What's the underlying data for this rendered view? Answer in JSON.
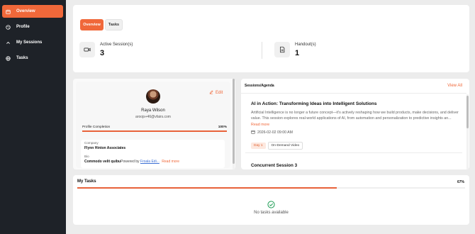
{
  "sidebar": {
    "items": [
      {
        "label": "Overview",
        "icon": "calendar-icon",
        "active": true
      },
      {
        "label": "Profile",
        "icon": "palette-icon",
        "active": false
      },
      {
        "label": "My Sessions",
        "icon": "chevron-up-icon",
        "active": false
      },
      {
        "label": "Tasks",
        "icon": "globe-icon",
        "active": false
      }
    ]
  },
  "overview": {
    "tabs": [
      "Overview",
      "Tasks"
    ],
    "stats": [
      {
        "label": "Active Session(s)",
        "value": "3",
        "icon": "video-camera-icon"
      },
      {
        "label": "Handout(s)",
        "value": "1",
        "icon": "document-icon"
      }
    ]
  },
  "profile": {
    "edit_label": "Edit",
    "name": "Raya Wilson",
    "email": "aroojs+46@vfairs.com",
    "completion_label": "Profile Completion",
    "completion_value": "100%",
    "completion_fraction": 1.0,
    "company_label": "Company",
    "company_value": "Flynn Hinton Associates",
    "bio_label": "Bio",
    "bio_value": "Commodo velit quibu",
    "bio_powered": "Powered by ",
    "bio_link": "Froala Edi...",
    "read_more": "Read more"
  },
  "sessions": {
    "heading": "Sessions/Agenda",
    "view_all": "View All",
    "items": [
      {
        "title": "AI in Action: Transforming Ideas into Intelligent Solutions",
        "description": "Artificial Intelligence is no longer a future concept—it's actively reshaping how we build products, make decisions, and deliver value. This session explores real-world applications of AI, from automation and personalization to predictive insights an...",
        "read_more": "Read more",
        "datetime": "2026-02-02 09:00 AM",
        "tags": [
          "Day 1",
          "On-Demand Video"
        ]
      },
      {
        "title": "Concurrent Session 3"
      }
    ]
  },
  "tasks": {
    "heading": "My Tasks",
    "progress_value": "67%",
    "progress_fraction": 0.67,
    "empty_text": "No tasks available",
    "empty_icon": "check-circle-icon"
  },
  "colors": {
    "accent": "#f0683a",
    "sidebar": "#1e2228",
    "background": "#ececec"
  }
}
